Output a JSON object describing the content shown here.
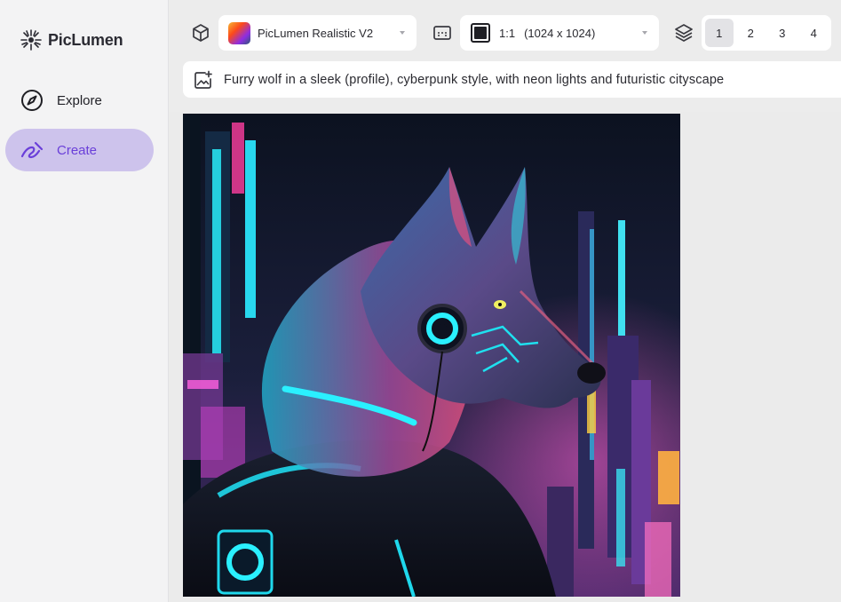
{
  "app": {
    "name": "PicLumen"
  },
  "sidebar": {
    "items": [
      {
        "label": "Explore",
        "icon": "compass-icon",
        "active": false
      },
      {
        "label": "Create",
        "icon": "create-pen-icon",
        "active": true
      }
    ]
  },
  "toolbar": {
    "model_icon": "cube-icon",
    "model": "PicLumen Realistic V2",
    "ratio_icon": "aspect-ratio-icon",
    "ratio": "1:1",
    "size": "(1024 x 1024)",
    "batch_icon": "layers-icon",
    "batch_counts": [
      "1",
      "2",
      "3",
      "4"
    ],
    "batch_selected": "1"
  },
  "prompt": {
    "icon": "image-add-icon",
    "text": "Furry wolf in a sleek (profile), cyberpunk style, with neon lights and futuristic cityscape"
  },
  "colors": {
    "accent": "#6a3fd9",
    "active_nav_bg": "#cdc3ec",
    "sidebar_bg": "#f3f3f4",
    "main_bg": "#ebebeb"
  }
}
